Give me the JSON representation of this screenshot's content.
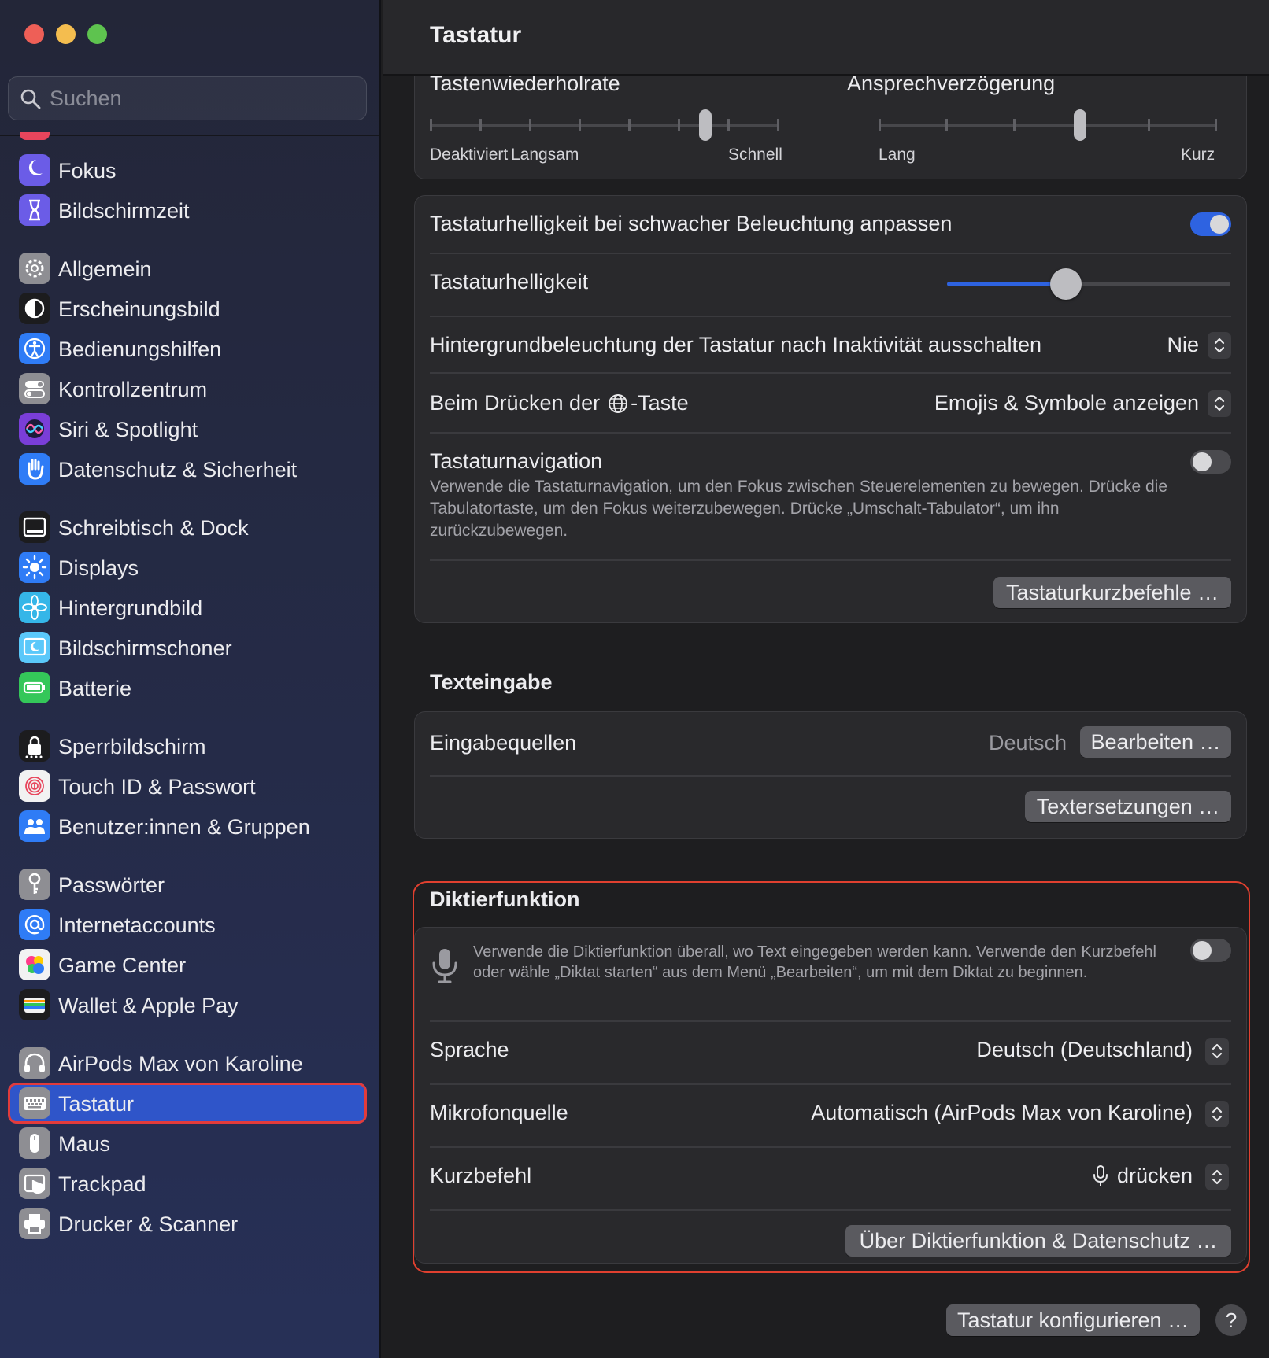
{
  "window": {
    "title": "Tastatur"
  },
  "sidebar": {
    "search_placeholder": "Suchen",
    "items": [
      {
        "label": "Fokus",
        "icon": "moon-icon",
        "color": "#6b5ce7"
      },
      {
        "label": "Bildschirmzeit",
        "icon": "hourglass-icon",
        "color": "#6b5ce7"
      },
      {
        "label": "Allgemein",
        "icon": "gear-icon",
        "color": "#8e8e93"
      },
      {
        "label": "Erscheinungsbild",
        "icon": "appearance-icon",
        "color": "#1c1c1e"
      },
      {
        "label": "Bedienungshilfen",
        "icon": "accessibility-icon",
        "color": "#2f7cf6"
      },
      {
        "label": "Kontrollzentrum",
        "icon": "switches-icon",
        "color": "#8e8e93"
      },
      {
        "label": "Siri & Spotlight",
        "icon": "siri-icon",
        "color": "#7a3ed8"
      },
      {
        "label": "Datenschutz & Sicherheit",
        "icon": "hand-icon",
        "color": "#2f7cf6"
      },
      {
        "label": "Schreibtisch & Dock",
        "icon": "dock-icon",
        "color": "#1c1c1e"
      },
      {
        "label": "Displays",
        "icon": "sun-icon",
        "color": "#2f7cf6"
      },
      {
        "label": "Hintergrundbild",
        "icon": "flower-icon",
        "color": "#35b6e8"
      },
      {
        "label": "Bildschirmschoner",
        "icon": "screensaver-icon",
        "color": "#5ac8fa"
      },
      {
        "label": "Batterie",
        "icon": "battery-icon",
        "color": "#34c759"
      },
      {
        "label": "Sperrbildschirm",
        "icon": "lock-icon",
        "color": "#1c1c1e"
      },
      {
        "label": "Touch ID & Passwort",
        "icon": "fingerprint-icon",
        "color": "#f2f2f2"
      },
      {
        "label": "Benutzer:innen & Gruppen",
        "icon": "users-icon",
        "color": "#2f7cf6"
      },
      {
        "label": "Passwörter",
        "icon": "key-icon",
        "color": "#8e8e93"
      },
      {
        "label": "Internetaccounts",
        "icon": "at-icon",
        "color": "#2f7cf6"
      },
      {
        "label": "Game Center",
        "icon": "gamecenter-icon",
        "color": "#f2f2f2"
      },
      {
        "label": "Wallet & Apple Pay",
        "icon": "wallet-icon",
        "color": "#1c1c1e"
      },
      {
        "label": "AirPods Max von Karoline",
        "icon": "headphones-icon",
        "color": "#8e8e93"
      },
      {
        "label": "Tastatur",
        "icon": "keyboard-icon",
        "color": "#8e8e93"
      },
      {
        "label": "Maus",
        "icon": "mouse-icon",
        "color": "#8e8e93"
      },
      {
        "label": "Trackpad",
        "icon": "trackpad-icon",
        "color": "#8e8e93"
      },
      {
        "label": "Drucker & Scanner",
        "icon": "printer-icon",
        "color": "#8e8e93"
      }
    ]
  },
  "repeat_card": {
    "repeat_rate_title": "Tastenwiederholrate",
    "repeat_rate_value": 0.8,
    "repeat_rate_labels": [
      "Deaktiviert",
      "Langsam",
      "Schnell"
    ],
    "delay_title": "Ansprechverzögerung",
    "delay_value": 0.6,
    "delay_labels": [
      "Lang",
      "Kurz"
    ]
  },
  "brightness_card": {
    "auto_brightness_label": "Tastaturhelligkeit bei schwacher Beleuchtung anpassen",
    "auto_brightness_on": true,
    "brightness_label": "Tastaturhelligkeit",
    "brightness_value": 0.42,
    "backlight_off_label": "Hintergrundbeleuchtung der Tastatur nach Inaktivität ausschalten",
    "backlight_off_value": "Nie",
    "globe_key_label_pre": "Beim Drücken der",
    "globe_key_label_post": "-Taste",
    "globe_key_value": "Emojis & Symbole anzeigen",
    "navigation_label": "Tastaturnavigation",
    "navigation_on": false,
    "navigation_desc": "Verwende die Tastaturnavigation, um den Fokus zwischen Steuerelementen zu bewegen. Drücke die Tabulatortaste, um den Fokus weiterzubewegen. Drücke „Umschalt-Tabulator“, um ihn zurückzubewegen.",
    "shortcuts_button": "Tastaturkurzbefehle …"
  },
  "text_input": {
    "section_title": "Texteingabe",
    "sources_label": "Eingabequellen",
    "sources_value": "Deutsch",
    "edit_button": "Bearbeiten …",
    "replacements_button": "Textersetzungen …"
  },
  "dictation": {
    "section_title": "Diktierfunktion",
    "desc": "Verwende die Diktierfunktion überall, wo Text eingegeben werden kann. Verwende den Kurzbefehl oder wähle „Diktat starten“ aus dem Menü „Bearbeiten“, um mit dem Diktat zu beginnen.",
    "enabled": false,
    "language_label": "Sprache",
    "language_value": "Deutsch (Deutschland)",
    "mic_label": "Mikrofonquelle",
    "mic_value": "Automatisch (AirPods Max von Karoline)",
    "shortcut_label": "Kurzbefehl",
    "shortcut_value": "drücken",
    "about_button": "Über Diktierfunktion & Datenschutz …",
    "highlight_color": "#e0402f"
  },
  "footer": {
    "configure_button": "Tastatur konfigurieren …",
    "help_button": "?"
  }
}
